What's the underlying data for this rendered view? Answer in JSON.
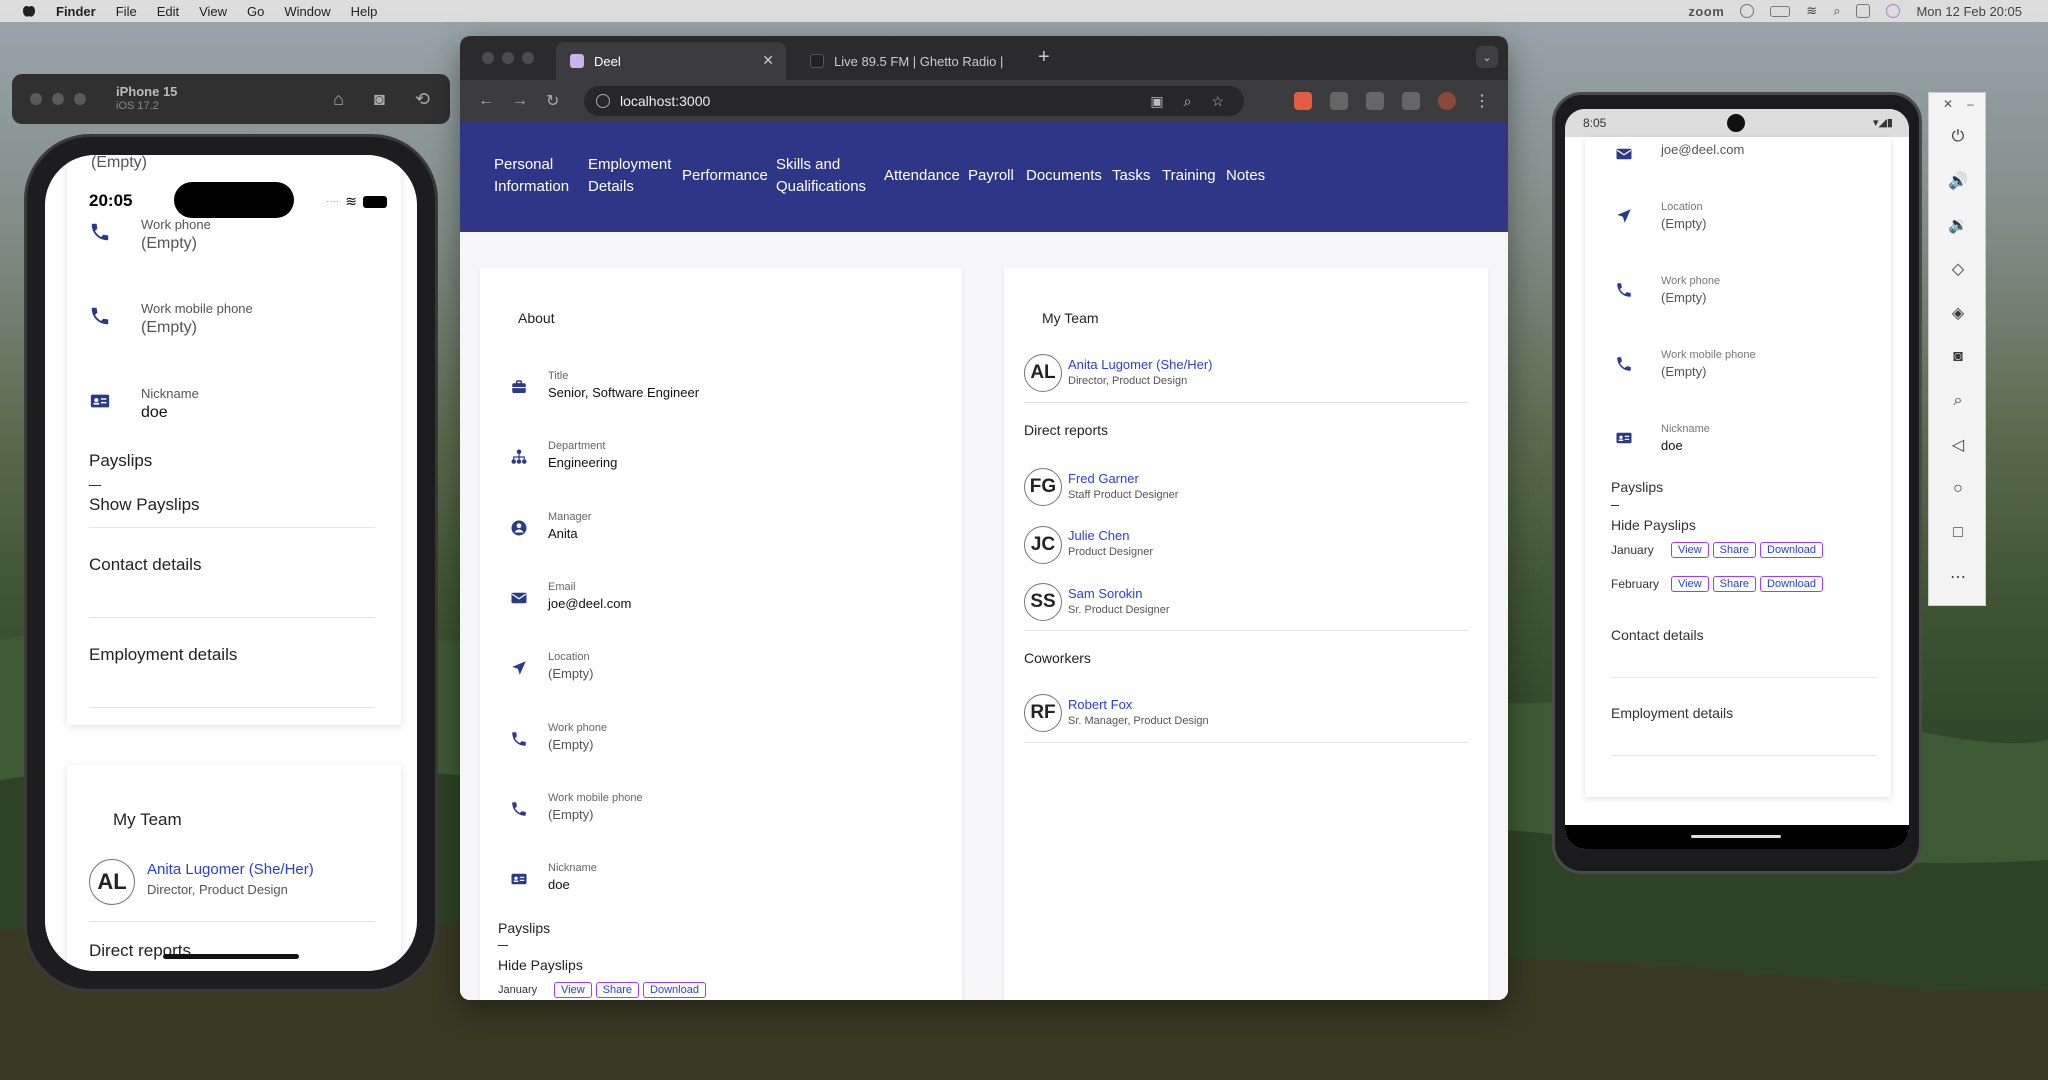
{
  "menubar": {
    "app": "Finder",
    "items": [
      "File",
      "Edit",
      "View",
      "Go",
      "Window",
      "Help"
    ],
    "zoom_label": "zoom",
    "clock": "Mon 12 Feb  20:05"
  },
  "ios_sim": {
    "device": "iPhone 15",
    "os": "iOS 17.2",
    "time": "20:05",
    "top_partial": "(Empty)",
    "fields": [
      {
        "label": "Work phone",
        "value": "(Empty)",
        "icon": "phone-icon"
      },
      {
        "label": "Work mobile phone",
        "value": "(Empty)",
        "icon": "phone-icon"
      },
      {
        "label": "Nickname",
        "value": "doe",
        "icon": "id-card-icon"
      }
    ],
    "payslips_title": "Payslips",
    "payslips_toggle": "Show Payslips",
    "contact_details": "Contact details",
    "employment_details": "Employment details",
    "team_title": "My Team",
    "manager": {
      "initials": "AL",
      "name": "Anita Lugomer (She/Her)",
      "role": "Director, Product Design"
    },
    "cut_heading": "Direct reports"
  },
  "browser": {
    "tabs": [
      {
        "title": "Deel",
        "active": true
      },
      {
        "title": "Live 89.5 FM | Ghetto Radio |",
        "active": false
      }
    ],
    "url": "localhost:3000",
    "nav": [
      "Personal Information",
      "Employment Details",
      "Performance",
      "Skills and Qualifications",
      "Attendance",
      "Payroll",
      "Documents",
      "Tasks",
      "Training",
      "Notes"
    ],
    "about": {
      "title": "About",
      "fields": [
        {
          "label": "Title",
          "value": "Senior, Software Engineer",
          "icon": "briefcase-icon"
        },
        {
          "label": "Department",
          "value": "Engineering",
          "icon": "org-chart-icon"
        },
        {
          "label": "Manager",
          "value": "Anita",
          "icon": "person-icon"
        },
        {
          "label": "Email",
          "value": "joe@deel.com",
          "icon": "mail-icon"
        },
        {
          "label": "Location",
          "value": "(Empty)",
          "icon": "location-arrow-icon"
        },
        {
          "label": "Work phone",
          "value": "(Empty)",
          "icon": "phone-icon"
        },
        {
          "label": "Work mobile phone",
          "value": "(Empty)",
          "icon": "phone-icon"
        },
        {
          "label": "Nickname",
          "value": "doe",
          "icon": "id-card-icon"
        }
      ],
      "payslips_title": "Payslips",
      "payslips_toggle": "Hide Payslips",
      "row_month": "January",
      "buttons": [
        "View",
        "Share",
        "Download"
      ]
    },
    "team": {
      "title": "My Team",
      "manager": {
        "initials": "AL",
        "name": "Anita Lugomer (She/Her)",
        "role": "Director, Product Design"
      },
      "direct_reports_title": "Direct reports",
      "direct_reports": [
        {
          "initials": "FG",
          "name": "Fred Garner",
          "role": "Staff Product Designer"
        },
        {
          "initials": "JC",
          "name": "Julie Chen",
          "role": "Product Designer"
        },
        {
          "initials": "SS",
          "name": "Sam Sorokin",
          "role": "Sr. Product Designer"
        }
      ],
      "coworkers_title": "Coworkers",
      "coworkers": [
        {
          "initials": "RF",
          "name": "Robert Fox",
          "role": "Sr. Manager, Product Design"
        }
      ]
    }
  },
  "android": {
    "time": "8:05",
    "email": "joe@deel.com",
    "fields": [
      {
        "label": "Location",
        "value": "(Empty)",
        "icon": "location-arrow-icon"
      },
      {
        "label": "Work phone",
        "value": "(Empty)",
        "icon": "phone-icon"
      },
      {
        "label": "Work mobile phone",
        "value": "(Empty)",
        "icon": "phone-icon"
      },
      {
        "label": "Nickname",
        "value": "doe",
        "icon": "id-card-icon"
      }
    ],
    "payslips_title": "Payslips",
    "payslips_toggle": "Hide Payslips",
    "payslips": [
      {
        "month": "January",
        "buttons": [
          "View",
          "Share",
          "Download"
        ]
      },
      {
        "month": "February",
        "buttons": [
          "View",
          "Share",
          "Download"
        ]
      }
    ],
    "contact_details": "Contact details",
    "employment_details": "Employment details",
    "panel_controls": [
      "power-icon",
      "volume-up-icon",
      "volume-down-icon",
      "rotate-left-icon",
      "rotate-right-icon",
      "camera-icon",
      "zoom-icon",
      "back-icon",
      "home-icon",
      "overview-icon",
      "more-icon"
    ]
  },
  "colors": {
    "nav_bg": "#2f3687",
    "link": "#2c40d0",
    "button_border": "#9b3ff0"
  }
}
